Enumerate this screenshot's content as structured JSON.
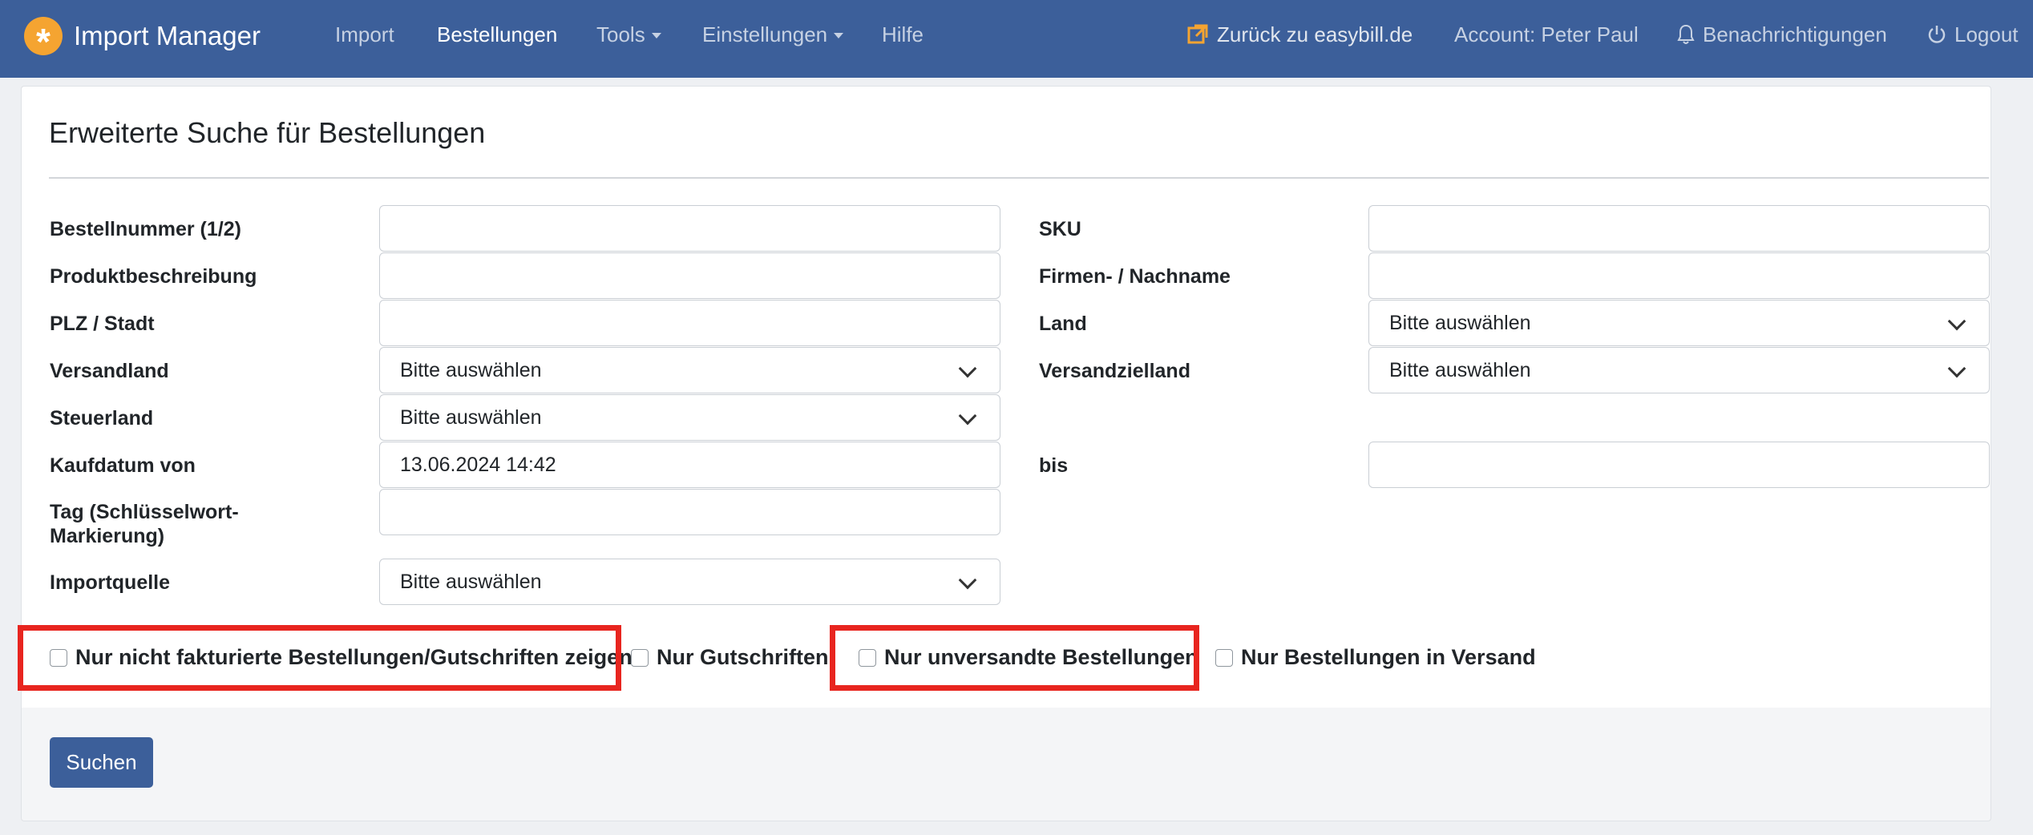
{
  "navbar": {
    "brand": "Import Manager",
    "brand_logo_icon": "asterisk-icon",
    "links": {
      "import": "Import",
      "bestellungen": "Bestellungen",
      "tools": "Tools",
      "einstellungen": "Einstellungen",
      "hilfe": "Hilfe"
    },
    "back_link": "Zurück zu easybill.de",
    "account": "Account: Peter Paul",
    "notifications": "Benachrichtigungen",
    "logout": "Logout",
    "accent_color": "#3c5f9a",
    "logo_color": "#f5a431"
  },
  "page": {
    "title": "Erweiterte Suche für Bestellungen"
  },
  "form": {
    "order_number": {
      "label": "Bestellnummer (1/2)",
      "value": ""
    },
    "sku": {
      "label": "SKU",
      "value": ""
    },
    "product_description": {
      "label": "Produktbeschreibung",
      "value": ""
    },
    "company_name": {
      "label": "Firmen- / Nachname",
      "value": ""
    },
    "zip_city": {
      "label": "PLZ / Stadt",
      "value": ""
    },
    "country": {
      "label": "Land",
      "value": "Bitte auswählen"
    },
    "shipping_country": {
      "label": "Versandland",
      "value": "Bitte auswählen"
    },
    "destination_country": {
      "label": "Versandzielland",
      "value": "Bitte auswählen"
    },
    "tax_country": {
      "label": "Steuerland",
      "value": "Bitte auswählen"
    },
    "purchase_date_from": {
      "label": "Kaufdatum von",
      "value": "13.06.2024 14:42"
    },
    "purchase_date_to": {
      "label": "bis",
      "value": ""
    },
    "tag": {
      "label": "Tag (Schlüsselwort-Markierung)",
      "value": ""
    },
    "import_source": {
      "label": "Importquelle",
      "value": "Bitte auswählen"
    }
  },
  "checkboxes": {
    "not_invoiced": {
      "label": "Nur nicht fakturierte Bestellungen/Gutschriften zeigen",
      "checked": false
    },
    "credit_notes": {
      "label": "Nur Gutschriften",
      "checked": false
    },
    "unshipped": {
      "label": "Nur unversandte Bestellungen",
      "checked": false
    },
    "in_shipping": {
      "label": "Nur Bestellungen in Versand",
      "checked": false
    }
  },
  "actions": {
    "search_label": "Suchen"
  },
  "annotation_color": "#e8251f"
}
